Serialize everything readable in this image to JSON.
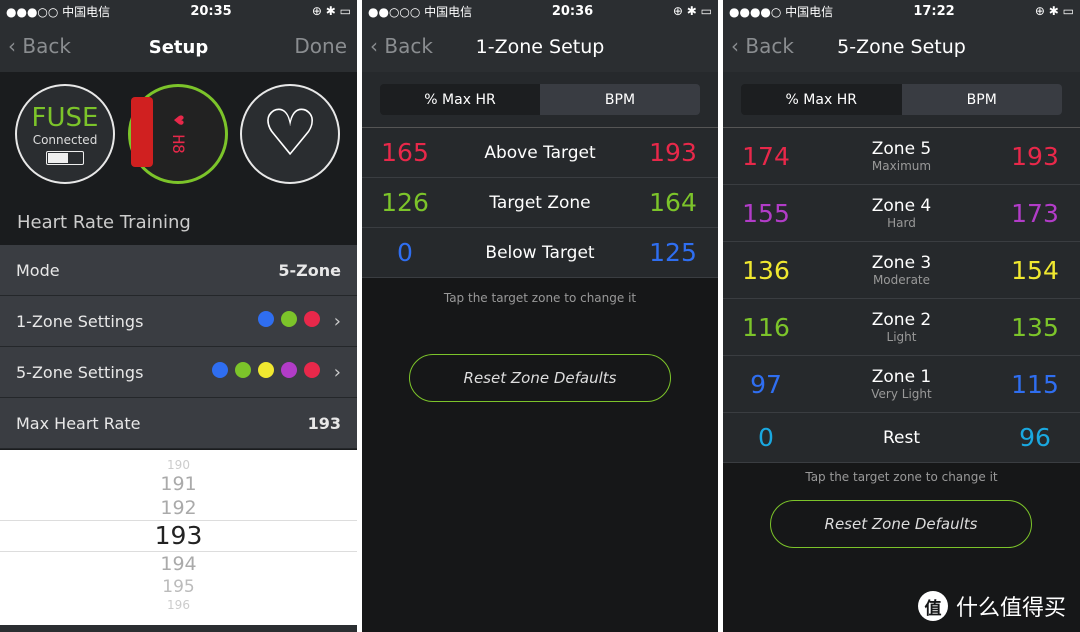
{
  "screens": [
    {
      "status": {
        "carrier": "●●●○○ 中国电信",
        "time": "20:35",
        "right": "⊕ ✱ ▭"
      },
      "nav": {
        "back": "Back",
        "title": "Setup",
        "done": "Done"
      },
      "device": {
        "name": "FUSE",
        "state": "Connected",
        "battery_level": 0.6
      },
      "section": "Heart Rate Training",
      "rows": [
        {
          "label": "Mode",
          "value": "5-Zone"
        },
        {
          "label": "1-Zone Settings",
          "colors": [
            "#2f6ef0",
            "#7cc42a",
            "#e8284a"
          ]
        },
        {
          "label": "5-Zone Settings",
          "colors": [
            "#2f6ef0",
            "#7cc42a",
            "#f0e830",
            "#b23cc8",
            "#e8284a"
          ]
        },
        {
          "label": "Max Heart Rate",
          "value": "193"
        }
      ],
      "picker": {
        "values": [
          "190",
          "191",
          "192",
          "193",
          "194",
          "195",
          "196"
        ],
        "selected": "193"
      }
    },
    {
      "status": {
        "carrier": "●●○○○ 中国电信",
        "time": "20:36",
        "right": "⊕ ✱ ▭"
      },
      "nav": {
        "back": "Back",
        "title": "1-Zone Setup"
      },
      "segments": [
        "% Max HR",
        "BPM"
      ],
      "selected_segment": "BPM",
      "zones": [
        {
          "low": "165",
          "name": "Above Target",
          "high": "193",
          "color": "#e8284a"
        },
        {
          "low": "126",
          "name": "Target Zone",
          "high": "164",
          "color": "#7cc42a"
        },
        {
          "low": "0",
          "name": "Below Target",
          "high": "125",
          "color": "#2f6ef0"
        }
      ],
      "hint": "Tap the target zone to change it",
      "reset": "Reset Zone Defaults"
    },
    {
      "status": {
        "carrier": "●●●●○ 中国电信",
        "time": "17:22",
        "right": "⊕ ✱ ▭"
      },
      "nav": {
        "back": "Back",
        "title": "5-Zone Setup"
      },
      "segments": [
        "% Max HR",
        "BPM"
      ],
      "selected_segment": "BPM",
      "zones": [
        {
          "low": "174",
          "name": "Zone 5",
          "sub": "Maximum",
          "high": "193",
          "color": "#e8284a"
        },
        {
          "low": "155",
          "name": "Zone 4",
          "sub": "Hard",
          "high": "173",
          "color": "#b23cc8"
        },
        {
          "low": "136",
          "name": "Zone 3",
          "sub": "Moderate",
          "high": "154",
          "color": "#f0e830"
        },
        {
          "low": "116",
          "name": "Zone 2",
          "sub": "Light",
          "high": "135",
          "color": "#7cc42a"
        },
        {
          "low": "97",
          "name": "Zone 1",
          "sub": "Very Light",
          "high": "115",
          "color": "#2f6ef0"
        },
        {
          "low": "0",
          "name": "Rest",
          "high": "96",
          "color": "#1aa8e0"
        }
      ],
      "hint": "Tap the target zone to change it",
      "reset": "Reset Zone Defaults"
    }
  ],
  "watermark": {
    "logo": "值",
    "text": "什么值得买"
  }
}
